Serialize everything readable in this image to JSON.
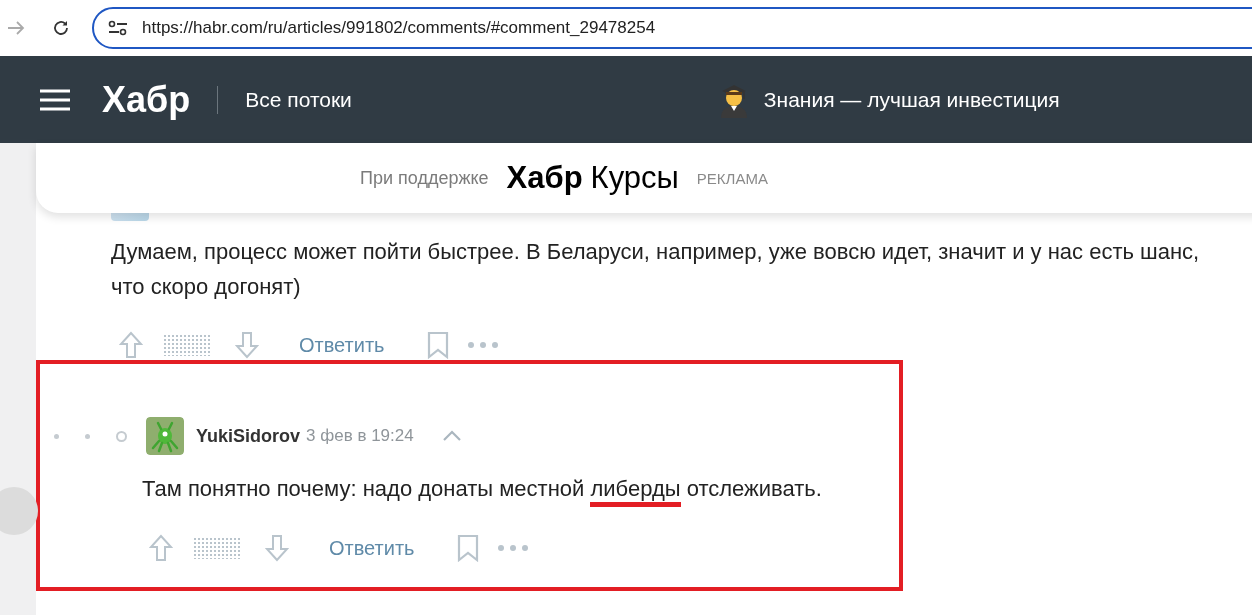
{
  "browser": {
    "url": "https://habr.com/ru/articles/991802/comments/#comment_29478254"
  },
  "header": {
    "logo": "Хабр",
    "section": "Все потоки",
    "promo": "Знания — лучшая инвестиция"
  },
  "sponsor": {
    "caption": "При поддержке",
    "brand": "Хабр",
    "product": "Курсы",
    "label": "РЕКЛАМА"
  },
  "comments": [
    {
      "kind": "parent",
      "framed": false,
      "segments": [
        {
          "text": "Думаем, процесс может пойти быстрее. В Беларуси, например, уже вовсю идет, значит и у нас есть шанс, что скоро догонят)",
          "highlighted": false
        }
      ],
      "reply": "Ответить"
    },
    {
      "kind": "reply",
      "framed": true,
      "author": "YukiSidorov",
      "time": "3 фев в 19:24",
      "segments": [
        {
          "text": "Там понятно почему: надо донаты местной ",
          "highlighted": false
        },
        {
          "text": "либерды",
          "highlighted": true
        },
        {
          "text": " отслеживать.",
          "highlighted": false
        }
      ],
      "reply": "Ответить"
    }
  ]
}
